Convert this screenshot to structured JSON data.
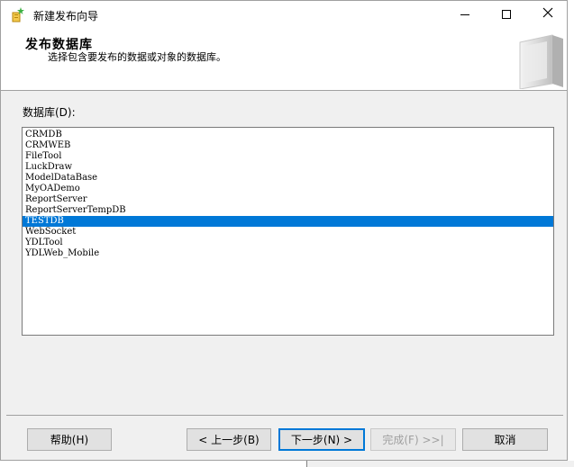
{
  "window": {
    "title": "新建发布向导"
  },
  "header": {
    "title": "发布数据库",
    "subtitle": "选择包含要发布的数据或对象的数据库。"
  },
  "database_list": {
    "label": "数据库(D):",
    "items": [
      "CRMDB",
      "CRMWEB",
      "FileTool",
      "LuckDraw",
      "ModelDataBase",
      "MyOADemo",
      "ReportServer",
      "ReportServerTempDB",
      "TESTDB",
      "WebSocket",
      "YDLTool",
      "YDLWeb_Mobile"
    ],
    "selected": "TESTDB"
  },
  "buttons": {
    "help": "帮助(H)",
    "back": "< 上一步(B)",
    "next": "下一步(N) >",
    "finish": "完成(F) >>|",
    "cancel": "取消"
  },
  "colors": {
    "selection": "#0078d7",
    "window_bg": "#f0f0f0"
  },
  "icons": {
    "app": "wizard-icon",
    "minimize": "minimize-icon",
    "maximize": "maximize-icon",
    "close": "close-icon",
    "header": "book-icon"
  }
}
